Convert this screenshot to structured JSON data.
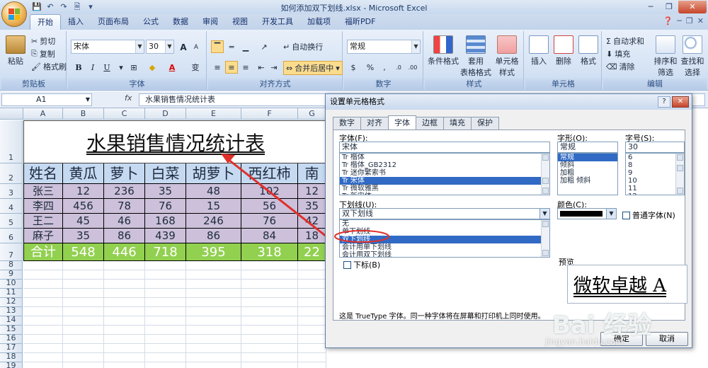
{
  "app": {
    "title": "如何添加双下划线.xlsx - Microsoft Excel",
    "minimize": "─",
    "restore": "❐",
    "close": "✕"
  },
  "qat": {
    "save": "💾",
    "undo": "↶",
    "redo": "↷",
    "print_preview": "🗎",
    "customize": "▾"
  },
  "tabs": [
    "开始",
    "插入",
    "页面布局",
    "公式",
    "数据",
    "审阅",
    "视图",
    "开发工具",
    "加载项",
    "福昕PDF"
  ],
  "ribbon": {
    "clipboard": {
      "label": "剪贴板",
      "paste": "粘贴",
      "cut": "剪切",
      "copy": "复制",
      "format_painter": "格式刷"
    },
    "font": {
      "label": "字体",
      "font_name": "宋体",
      "font_size": "30",
      "bold": "B",
      "italic": "I",
      "underline": "U",
      "grow": "A",
      "shrink": "A",
      "wen": "变"
    },
    "alignment": {
      "label": "对齐方式",
      "wrap": "自动换行",
      "merge": "合并后居中"
    },
    "number": {
      "label": "数字",
      "format": "常规",
      "percent": "%",
      "comma": ",",
      "currency": "$"
    },
    "styles": {
      "label": "样式",
      "cond": "条件格式",
      "table": "套用\n表格格式",
      "cell": "单元格\n样式"
    },
    "cells": {
      "label": "单元格",
      "insert": "插入",
      "delete": "删除",
      "format": "格式"
    },
    "editing": {
      "label": "编辑",
      "autosum": "自动求和",
      "fill": "填充",
      "clear": "清除",
      "sort": "排序和\n筛选",
      "find": "查找和\n选择"
    }
  },
  "formula_bar": {
    "name_box": "A1",
    "fx": "fx",
    "formula": "水果销售情况统计表"
  },
  "sheet": {
    "columns": [
      "A",
      "B",
      "C",
      "D",
      "E",
      "F",
      "G"
    ],
    "rows": [
      "1",
      "2",
      "3",
      "4",
      "5",
      "6",
      "7",
      "8",
      "9",
      "10",
      "11",
      "12",
      "13",
      "14",
      "15",
      "16",
      "17",
      "18",
      "19",
      "20"
    ],
    "title": "水果销售情况统计表",
    "header": [
      "姓名",
      "黄瓜",
      "萝卜",
      "白菜",
      "胡萝卜",
      "西红柿",
      "南瓜"
    ],
    "data": [
      [
        "张三",
        "12",
        "236",
        "35",
        "48",
        "102",
        "12"
      ],
      [
        "李四",
        "456",
        "78",
        "76",
        "15",
        "56",
        "35"
      ],
      [
        "王二",
        "45",
        "46",
        "168",
        "246",
        "76",
        "42"
      ],
      [
        "麻子",
        "35",
        "86",
        "439",
        "86",
        "84",
        "18"
      ]
    ],
    "total": [
      "合计",
      "548",
      "446",
      "718",
      "395",
      "318",
      "22"
    ],
    "colors": {
      "header": "#c5d9f1",
      "data": "#ccc0da",
      "total": "#92d050"
    }
  },
  "dialog": {
    "title": "设置单元格格式",
    "help": "?",
    "close": "✕",
    "tabs": [
      "数字",
      "对齐",
      "字体",
      "边框",
      "填充",
      "保护"
    ],
    "font_label": "字体(F):",
    "font_value": "宋体",
    "font_list": [
      "Tr 楷体",
      "Tr 楷体_GB2312",
      "Tr 迷你繁索书",
      "Tr 宋体",
      "Tr 微软雅黑",
      "Tr 新宋体"
    ],
    "style_label": "字形(O):",
    "style_value": "常规",
    "style_list": [
      "常规",
      "倾斜",
      "加粗",
      "加粗 倾斜"
    ],
    "size_label": "字号(S):",
    "size_value": "30",
    "size_list": [
      "6",
      "8",
      "9",
      "10",
      "11",
      "12"
    ],
    "underline_label": "下划线(U):",
    "underline_value": "双下划线",
    "underline_list": [
      "无",
      "单下划线",
      "双下划线",
      "会计用单下划线",
      "会计用双下划线"
    ],
    "color_label": "颜色(C):",
    "normal_font": "普通字体(N)",
    "effects": "特殊效果",
    "strike": "删除线(K)",
    "superscript": "上标(E)",
    "subscript": "下标(B)",
    "preview_label": "预览",
    "preview_text": "微软卓越  A",
    "info": "这是 TrueType 字体。同一种字体将在屏幕和打印机上同时使用。",
    "ok": "确定",
    "cancel": "取消"
  },
  "watermark": {
    "main": "Bai 经验",
    "sub": "jingyan.baidu.com"
  }
}
